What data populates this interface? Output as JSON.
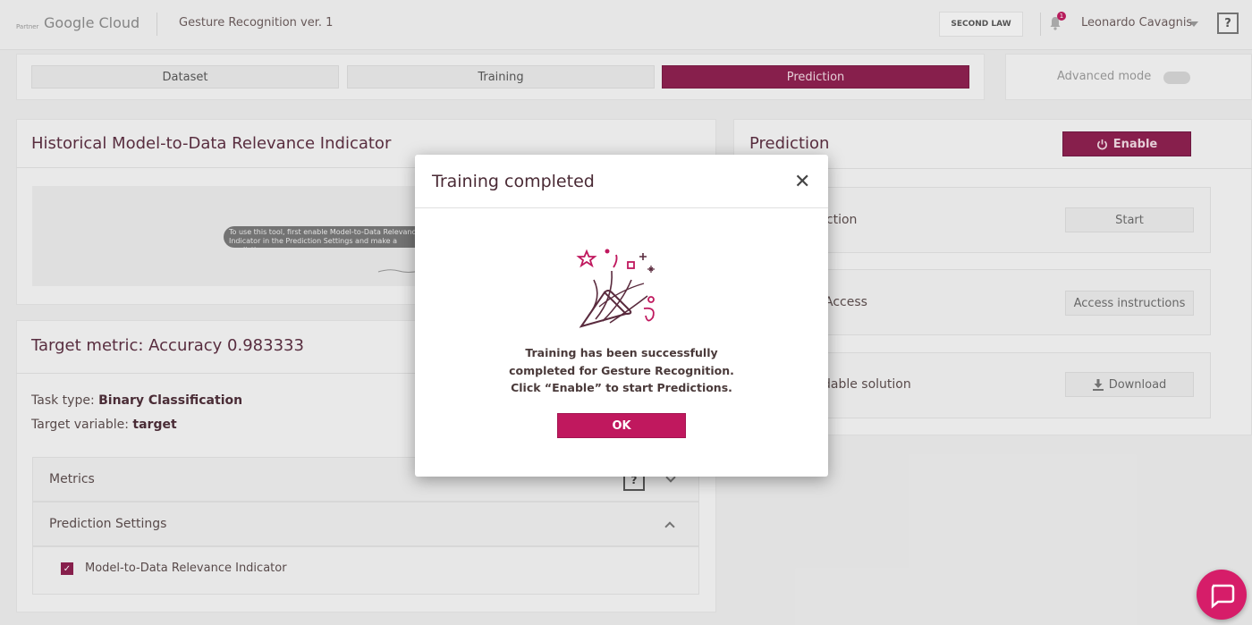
{
  "header": {
    "partner_label": "Partner",
    "brand": "Google Cloud",
    "project_title": "Gesture Recognition ver. 1",
    "org_button": "SECOND LAW",
    "notification_count": "1",
    "user_name": "Leonardo Cavagnis",
    "help": "?"
  },
  "tabs": [
    {
      "label": "Dataset",
      "active": false
    },
    {
      "label": "Training",
      "active": false
    },
    {
      "label": "Prediction",
      "active": true
    }
  ],
  "advanced_mode": {
    "label": "Advanced mode",
    "enabled": false
  },
  "left": {
    "historical_title": "Historical Model-to-Data Relevance Indicator",
    "chart_message": "To use this tool, first enable Model-to-Data Relevance Indicator in the Prediction Settings and make a prediction",
    "target_metric_title": "Target metric:  Accuracy 0.983333",
    "task_type_label": "Task type: ",
    "task_type_value": "Binary Classification",
    "target_variable_label": "Target variable: ",
    "target_variable_value": "target",
    "metrics_label": "Metrics",
    "metrics_help": "?",
    "prediction_settings_label": "Prediction Settings",
    "relevance_indicator_label": "Model-to-Data Relevance Indicator",
    "relevance_indicator_checked": true
  },
  "right": {
    "prediction_title": "Prediction",
    "enable_label": "Enable",
    "rows": [
      {
        "label": "iction",
        "button": "Start"
      },
      {
        "label": "Access",
        "button": "Access instructions"
      },
      {
        "label": "dable solution",
        "button": "Download"
      }
    ]
  },
  "modal": {
    "title": "Training completed",
    "close": "✕",
    "message_line1": "Training has been successfully",
    "message_line2": "completed for Gesture Recognition.",
    "message_line3": "Click “Enable” to start Predictions.",
    "ok_label": "OK",
    "icon": "celebration-popper-icon"
  },
  "colors": {
    "brand": "#8d1c4c",
    "accent": "#c0185e",
    "chat": "#d61d69"
  }
}
